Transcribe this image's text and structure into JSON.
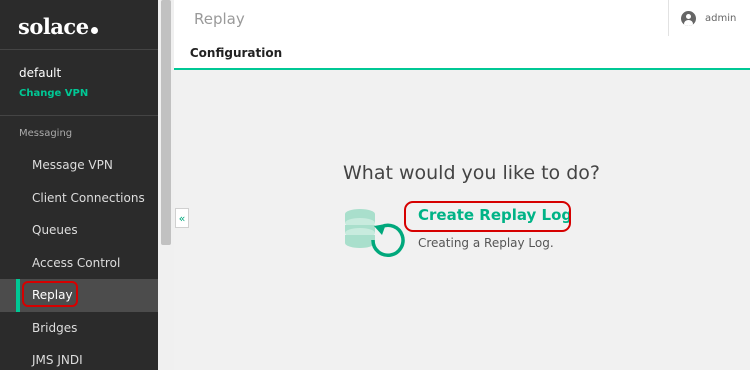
{
  "brand": {
    "logo_text": "solace"
  },
  "vpn": {
    "name": "default",
    "change_label": "Change VPN"
  },
  "nav": {
    "section_label": "Messaging",
    "items": [
      {
        "label": "Message VPN"
      },
      {
        "label": "Client Connections"
      },
      {
        "label": "Queues"
      },
      {
        "label": "Access Control"
      },
      {
        "label": "Replay",
        "active": true
      },
      {
        "label": "Bridges"
      },
      {
        "label": "JMS JNDI"
      }
    ]
  },
  "header": {
    "title": "Replay",
    "user": "admin",
    "tabs": [
      {
        "label": "Configuration",
        "active": true
      }
    ]
  },
  "collapse": {
    "icon": "double-chevron-left-icon",
    "glyph": "«"
  },
  "main": {
    "question": "What would you like to do?",
    "action_label": "Create Replay Log",
    "action_description": "Creating a Replay Log."
  },
  "colors": {
    "accent": "#00c895",
    "sidebar_bg": "#2b2b2b",
    "highlight": "#d60000"
  }
}
